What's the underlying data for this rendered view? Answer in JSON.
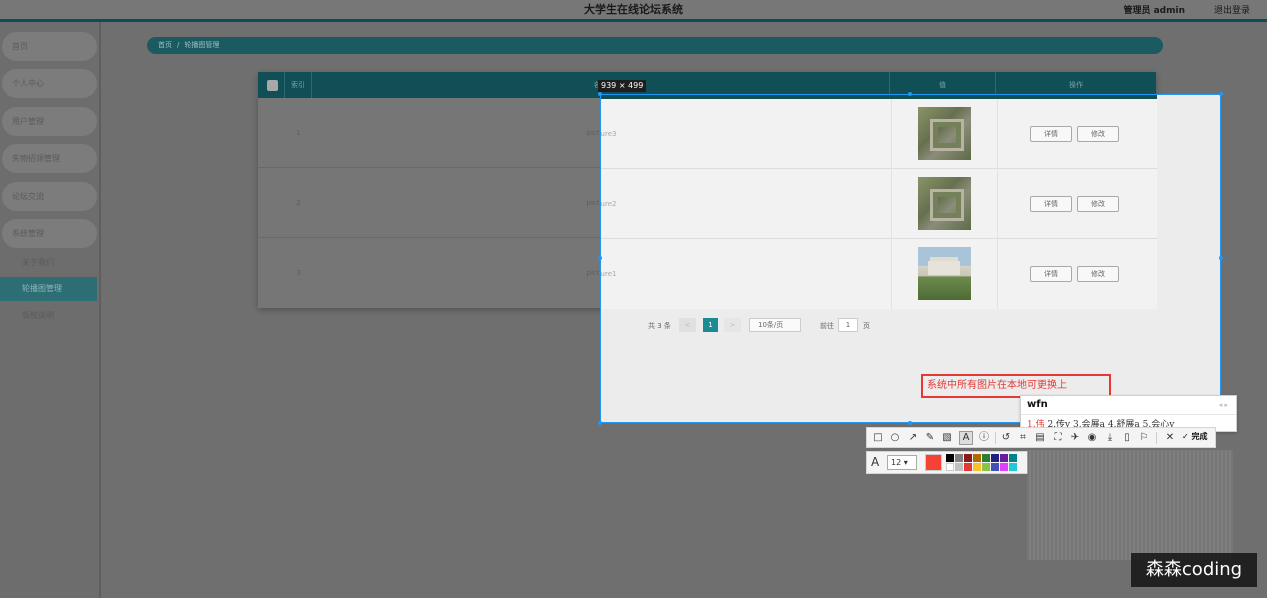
{
  "header": {
    "title": "大学生在线论坛系统",
    "admin_label": "管理员 admin",
    "logout_label": "退出登录"
  },
  "sidebar": {
    "items": [
      {
        "label": "首页"
      },
      {
        "label": "个人中心"
      },
      {
        "label": "用户管理"
      },
      {
        "label": "失物招领管理"
      },
      {
        "label": "论坛交流"
      },
      {
        "label": "系统管理"
      }
    ],
    "subitems": [
      {
        "label": "关于我们"
      },
      {
        "label": "轮播图管理"
      },
      {
        "label": "版权说明"
      }
    ]
  },
  "breadcrumb": {
    "home": "首页",
    "separator": "/",
    "current": "轮播图管理"
  },
  "table": {
    "headers": {
      "index": "索引",
      "name": "名称",
      "image": "值",
      "actions": "操作"
    },
    "rows": [
      {
        "index": "1",
        "name": "picture3",
        "thumb": "campus-aerial"
      },
      {
        "index": "2",
        "name": "picture2",
        "thumb": "campus-aerial"
      },
      {
        "index": "3",
        "name": "picture1",
        "thumb": "building-gate"
      }
    ],
    "detail_label": "详情",
    "edit_label": "修改"
  },
  "pagination": {
    "total": "共 3 条",
    "prev": "<",
    "current_page": "1",
    "next": ">",
    "page_size": "10条/页",
    "goto_label": "前往",
    "goto_value": "1",
    "page_suffix": "页"
  },
  "capture": {
    "dimensions": "939 × 499",
    "annotation_text": "系统中所有图片在本地可更换上"
  },
  "ime": {
    "composition": "wfn",
    "candidates": [
      "1.伟",
      "2.传y",
      "3.会展a",
      "4.舒展a",
      "5.会心y"
    ]
  },
  "toolbar": {
    "done_label": "完成",
    "font_size": "12",
    "current_color": "#f44336"
  },
  "watermark": "森森coding",
  "colors": {
    "accent": "#0f4f55",
    "primary_teal": "#1b8b93",
    "selection": "#2196f3",
    "annotation": "#e53935"
  }
}
